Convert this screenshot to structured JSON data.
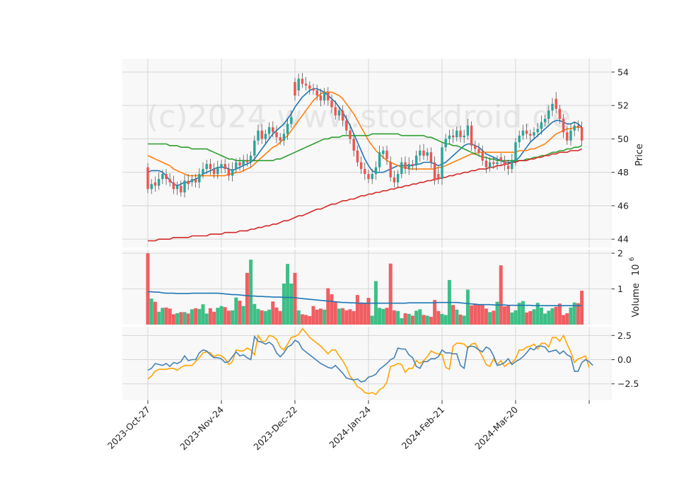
{
  "watermark": "(c)2024 www.stockdroid.de",
  "chart_data": {
    "type": "candlestick",
    "panels": {
      "price": {
        "ylabel": "Price",
        "ylim": [
          43.5,
          54.8
        ],
        "yticks": [
          44,
          46,
          48,
          50,
          52,
          54
        ]
      },
      "volume": {
        "ylabel": "Volume",
        "exponent_label": "10",
        "exponent": "6",
        "ylim": [
          0,
          2.1
        ],
        "yticks": [
          1,
          2
        ]
      },
      "oscillator": {
        "ylim": [
          -4.2,
          3.4
        ],
        "yticks": [
          2.5,
          0.0,
          -2.5
        ],
        "ytick_labels": [
          "2.5",
          "0.0",
          "−2.5"
        ]
      }
    },
    "x_ticks": [
      {
        "index": 0,
        "label": "2023-Oct-27"
      },
      {
        "index": 20,
        "label": "2023-Nov-24"
      },
      {
        "index": 40,
        "label": "2023-Dec-22"
      },
      {
        "index": 60,
        "label": "2024-Jan-24"
      },
      {
        "index": 80,
        "label": "2024-Feb-21"
      },
      {
        "index": 100,
        "label": "2024-Mar-20"
      },
      {
        "index": 120,
        "label": ""
      }
    ],
    "num_bars": 119,
    "close": [
      47.0,
      47.3,
      47.2,
      47.6,
      47.9,
      47.6,
      47.4,
      47.0,
      47.2,
      46.8,
      47.5,
      47.3,
      47.6,
      47.4,
      47.9,
      48.2,
      48.5,
      48.2,
      47.9,
      48.3,
      48.5,
      48.2,
      47.8,
      48.2,
      48.6,
      48.4,
      48.7,
      48.6,
      49.0,
      49.9,
      50.5,
      50.0,
      50.3,
      50.7,
      50.4,
      50.1,
      49.9,
      50.3,
      50.9,
      51.3,
      52.6,
      53.6,
      53.3,
      53.2,
      53.0,
      52.9,
      52.6,
      52.3,
      52.8,
      52.3,
      51.9,
      51.4,
      51.7,
      51.1,
      50.5,
      50.0,
      49.3,
      48.6,
      48.2,
      47.9,
      47.6,
      47.9,
      48.3,
      49.2,
      49.3,
      48.8,
      47.7,
      47.4,
      47.9,
      48.6,
      48.2,
      48.5,
      48.4,
      49.0,
      49.3,
      49.0,
      49.2,
      48.6,
      47.5,
      47.6,
      49.5,
      50.0,
      50.2,
      50.1,
      50.5,
      50.1,
      50.2,
      50.8,
      49.6,
      49.4,
      49.2,
      48.7,
      48.3,
      48.6,
      48.5,
      48.6,
      48.7,
      48.4,
      48.2,
      48.7,
      49.8,
      50.2,
      50.5,
      50.3,
      50.2,
      50.4,
      50.6,
      51.0,
      51.2,
      51.7,
      52.1,
      51.8,
      51.2,
      50.4,
      49.9,
      50.5,
      50.8,
      50.7,
      49.9
    ],
    "open": [
      48.3,
      47.0,
      47.4,
      47.2,
      47.6,
      47.9,
      47.6,
      47.4,
      47.0,
      47.2,
      46.8,
      47.5,
      47.4,
      47.6,
      47.4,
      47.9,
      48.2,
      48.5,
      48.2,
      47.9,
      48.3,
      48.5,
      48.2,
      47.8,
      48.2,
      48.6,
      48.4,
      48.7,
      48.6,
      49.0,
      49.9,
      50.5,
      50.0,
      50.3,
      50.7,
      50.4,
      50.1,
      49.9,
      50.3,
      50.9,
      53.4,
      52.9,
      53.6,
      53.3,
      53.2,
      53.0,
      52.9,
      52.6,
      52.3,
      52.8,
      52.3,
      51.9,
      51.4,
      51.7,
      51.1,
      50.5,
      50.0,
      49.3,
      48.6,
      48.2,
      47.9,
      47.6,
      47.9,
      48.3,
      49.1,
      49.3,
      48.6,
      47.7,
      47.4,
      47.9,
      48.6,
      48.2,
      48.5,
      48.4,
      49.0,
      49.3,
      49.0,
      49.2,
      48.6,
      47.9,
      47.6,
      49.5,
      50.0,
      50.2,
      50.1,
      50.5,
      50.1,
      50.2,
      50.8,
      49.6,
      49.4,
      49.2,
      48.7,
      48.3,
      48.6,
      48.5,
      48.9,
      48.7,
      48.4,
      48.2,
      48.7,
      49.8,
      50.2,
      50.5,
      50.3,
      50.2,
      50.4,
      50.6,
      51.0,
      51.2,
      51.7,
      52.4,
      51.8,
      51.2,
      50.4,
      49.9,
      50.5,
      50.8,
      50.7
    ],
    "volume": [
      2.0,
      0.73,
      0.64,
      0.36,
      0.47,
      0.48,
      0.45,
      0.29,
      0.32,
      0.35,
      0.35,
      0.31,
      0.43,
      0.46,
      0.44,
      0.57,
      0.31,
      0.46,
      0.36,
      0.47,
      0.52,
      0.49,
      0.39,
      0.4,
      0.76,
      0.67,
      0.52,
      1.45,
      1.82,
      0.58,
      0.44,
      0.4,
      0.38,
      0.42,
      0.65,
      0.48,
      0.38,
      1.15,
      1.7,
      1.15,
      1.45,
      0.4,
      0.29,
      0.27,
      0.24,
      0.52,
      0.42,
      0.45,
      0.42,
      1.02,
      0.85,
      0.63,
      0.45,
      0.46,
      0.4,
      0.43,
      0.38,
      0.83,
      0.62,
      0.6,
      0.75,
      0.25,
      1.22,
      0.47,
      0.44,
      0.47,
      1.71,
      0.4,
      0.38,
      0.18,
      0.32,
      0.3,
      0.25,
      0.39,
      0.43,
      0.27,
      0.25,
      0.22,
      0.69,
      0.38,
      0.3,
      0.27,
      1.25,
      0.55,
      0.42,
      0.28,
      0.25,
      0.98,
      0.54,
      0.59,
      0.56,
      0.55,
      0.45,
      0.35,
      0.39,
      0.64,
      1.66,
      0.51,
      0.53,
      0.34,
      0.4,
      0.61,
      0.66,
      0.34,
      0.38,
      0.43,
      0.61,
      0.48,
      0.31,
      0.39,
      0.46,
      0.5,
      0.59,
      0.27,
      0.32,
      0.48,
      0.62,
      0.6,
      0.95
    ],
    "volume_ma": [
      0.92,
      0.92,
      0.91,
      0.91,
      0.89,
      0.88,
      0.88,
      0.88,
      0.87,
      0.87,
      0.87,
      0.87,
      0.88,
      0.88,
      0.88,
      0.88,
      0.88,
      0.88,
      0.88,
      0.88,
      0.87,
      0.86,
      0.85,
      0.84,
      0.84,
      0.83,
      0.82,
      0.81,
      0.8,
      0.8,
      0.79,
      0.79,
      0.78,
      0.78,
      0.77,
      0.77,
      0.77,
      0.76,
      0.76,
      0.76,
      0.75,
      0.74,
      0.73,
      0.72,
      0.71,
      0.7,
      0.69,
      0.68,
      0.67,
      0.66,
      0.65,
      0.64,
      0.63,
      0.62,
      0.62,
      0.61,
      0.61,
      0.6,
      0.6,
      0.6,
      0.6,
      0.6,
      0.6,
      0.6,
      0.6,
      0.6,
      0.6,
      0.6,
      0.6,
      0.6,
      0.6,
      0.61,
      0.61,
      0.61,
      0.61,
      0.61,
      0.61,
      0.61,
      0.61,
      0.62,
      0.62,
      0.62,
      0.62,
      0.62,
      0.62,
      0.61,
      0.6,
      0.59,
      0.58,
      0.57,
      0.56,
      0.56,
      0.56,
      0.56,
      0.55,
      0.55,
      0.55,
      0.55,
      0.54,
      0.54,
      0.54,
      0.54,
      0.54,
      0.54,
      0.54,
      0.53,
      0.53,
      0.53,
      0.53,
      0.53,
      0.53,
      0.53,
      0.53,
      0.53,
      0.53,
      0.53,
      0.53,
      0.53,
      0.53
    ],
    "overlays": [
      {
        "color": "#1f77b4",
        "values": [
          48.0,
          48.1,
          48.1,
          48.1,
          48.0,
          47.8,
          47.5,
          47.3,
          47.2,
          47.3,
          47.4,
          47.4,
          47.5,
          47.6,
          47.7,
          47.9,
          48.0,
          48.1,
          48.2,
          48.3,
          48.3,
          48.3,
          48.2,
          48.1,
          48.2,
          48.3,
          48.4,
          48.5,
          48.6,
          48.8,
          49.1,
          49.4,
          49.7,
          50.0,
          50.3,
          50.5,
          50.7,
          50.9,
          51.2,
          51.5,
          51.9,
          52.2,
          52.5,
          52.7,
          52.9,
          53.0,
          53.0,
          52.9,
          52.8,
          52.6,
          52.4,
          52.2,
          51.9,
          51.6,
          51.2,
          50.8,
          50.3,
          49.8,
          49.3,
          48.8,
          48.4,
          48.1,
          48.0,
          48.0,
          48.0,
          48.1,
          48.2,
          48.3,
          48.4,
          48.4,
          48.4,
          48.4,
          48.4,
          48.5,
          48.5,
          48.6,
          48.6,
          48.6,
          48.5,
          48.4,
          48.5,
          48.6,
          48.8,
          49.0,
          49.2,
          49.4,
          49.6,
          49.7,
          49.7,
          49.6,
          49.5,
          49.3,
          49.1,
          49.0,
          48.9,
          48.8,
          48.7,
          48.6,
          48.6,
          48.6,
          48.7,
          48.9,
          49.2,
          49.5,
          49.8,
          50.0,
          50.2,
          50.4,
          50.6,
          50.8,
          51.0,
          51.1,
          51.1,
          51.0,
          50.9,
          50.9,
          51.0,
          50.9,
          50.7
        ]
      },
      {
        "color": "#ff7f0e",
        "values": [
          49.0,
          48.9,
          48.8,
          48.7,
          48.6,
          48.5,
          48.4,
          48.2,
          48.1,
          48.0,
          47.9,
          47.8,
          47.8,
          47.8,
          47.8,
          47.8,
          47.8,
          47.8,
          47.8,
          47.8,
          47.8,
          47.8,
          47.9,
          47.9,
          48.0,
          48.0,
          48.1,
          48.2,
          48.3,
          48.5,
          48.7,
          48.9,
          49.1,
          49.3,
          49.5,
          49.6,
          49.8,
          50.0,
          50.2,
          50.5,
          50.8,
          51.1,
          51.4,
          51.7,
          52.0,
          52.3,
          52.5,
          52.7,
          52.8,
          52.8,
          52.8,
          52.7,
          52.6,
          52.4,
          52.1,
          51.8,
          51.5,
          51.1,
          50.7,
          50.3,
          49.9,
          49.6,
          49.3,
          49.1,
          48.9,
          48.7,
          48.6,
          48.5,
          48.4,
          48.3,
          48.3,
          48.2,
          48.2,
          48.2,
          48.2,
          48.2,
          48.2,
          48.2,
          48.2,
          48.3,
          48.3,
          48.4,
          48.5,
          48.6,
          48.7,
          48.8,
          48.9,
          49.0,
          49.1,
          49.1,
          49.2,
          49.2,
          49.2,
          49.2,
          49.2,
          49.2,
          49.2,
          49.2,
          49.2,
          49.2,
          49.2,
          49.3,
          49.3,
          49.3,
          49.4,
          49.4,
          49.5,
          49.6,
          49.7,
          49.9,
          50.1,
          50.3,
          50.4,
          50.5,
          50.6,
          50.6,
          50.7,
          50.7,
          50.7
        ]
      },
      {
        "color": "#2ca02c",
        "values": [
          49.7,
          49.7,
          49.7,
          49.7,
          49.7,
          49.7,
          49.6,
          49.6,
          49.6,
          49.5,
          49.5,
          49.5,
          49.4,
          49.4,
          49.4,
          49.4,
          49.4,
          49.3,
          49.2,
          49.1,
          49.0,
          48.9,
          48.8,
          48.8,
          48.7,
          48.7,
          48.7,
          48.7,
          48.7,
          48.7,
          48.7,
          48.7,
          48.7,
          48.7,
          48.7,
          48.8,
          48.8,
          48.9,
          49.0,
          49.1,
          49.2,
          49.3,
          49.4,
          49.5,
          49.6,
          49.7,
          49.8,
          49.9,
          50.0,
          50.0,
          50.1,
          50.1,
          50.1,
          50.2,
          50.2,
          50.2,
          50.2,
          50.2,
          50.2,
          50.2,
          50.2,
          50.3,
          50.3,
          50.3,
          50.3,
          50.3,
          50.3,
          50.3,
          50.3,
          50.2,
          50.2,
          50.2,
          50.2,
          50.2,
          50.2,
          50.2,
          50.1,
          50.1,
          50.0,
          49.9,
          49.8,
          49.7,
          49.7,
          49.6,
          49.6,
          49.5,
          49.4,
          49.3,
          49.2,
          49.1,
          49.0,
          48.9,
          48.9,
          48.8,
          48.8,
          48.7,
          48.7,
          48.7,
          48.7,
          48.7,
          48.7,
          48.7,
          48.7,
          48.8,
          48.8,
          48.9,
          48.9,
          49.0,
          49.0,
          49.1,
          49.2,
          49.2,
          49.3,
          49.3,
          49.4,
          49.4,
          49.5,
          49.5,
          49.6
        ]
      },
      {
        "color": "#d62728",
        "values": [
          43.9,
          43.9,
          43.9,
          44.0,
          44.0,
          44.0,
          44.0,
          44.1,
          44.1,
          44.1,
          44.1,
          44.1,
          44.2,
          44.2,
          44.2,
          44.2,
          44.2,
          44.3,
          44.3,
          44.3,
          44.3,
          44.4,
          44.4,
          44.4,
          44.4,
          44.5,
          44.5,
          44.5,
          44.6,
          44.6,
          44.7,
          44.7,
          44.8,
          44.8,
          44.9,
          44.9,
          45.0,
          45.1,
          45.1,
          45.2,
          45.3,
          45.4,
          45.4,
          45.5,
          45.6,
          45.7,
          45.8,
          45.8,
          45.9,
          46.0,
          46.1,
          46.1,
          46.2,
          46.3,
          46.3,
          46.4,
          46.4,
          46.5,
          46.6,
          46.6,
          46.7,
          46.7,
          46.8,
          46.8,
          46.9,
          46.9,
          47.0,
          47.0,
          47.1,
          47.1,
          47.2,
          47.2,
          47.3,
          47.3,
          47.4,
          47.4,
          47.5,
          47.5,
          47.6,
          47.6,
          47.7,
          47.7,
          47.8,
          47.8,
          47.9,
          47.9,
          48.0,
          48.0,
          48.1,
          48.1,
          48.2,
          48.2,
          48.2,
          48.3,
          48.3,
          48.4,
          48.4,
          48.5,
          48.5,
          48.6,
          48.6,
          48.7,
          48.7,
          48.7,
          48.8,
          48.8,
          48.9,
          48.9,
          49.0,
          49.0,
          49.1,
          49.1,
          49.2,
          49.2,
          49.2,
          49.3,
          49.3,
          49.3,
          49.4
        ]
      }
    ],
    "oscillator_lines": [
      {
        "color": "#ffa500",
        "values": [
          -2.0,
          -1.7,
          -1.2,
          -1.0,
          -1.0,
          -1.0,
          -0.9,
          -0.9,
          -1.1,
          -0.8,
          -0.6,
          -0.6,
          -0.6,
          -0.2,
          0.2,
          0.7,
          0.8,
          0.7,
          0.3,
          0.5,
          0.4,
          0.1,
          -0.5,
          -0.2,
          1.0,
          0.9,
          0.9,
          1.2,
          1.0,
          0.5,
          2.5,
          1.9,
          1.9,
          2.5,
          2.4,
          2.1,
          1.3,
          1.0,
          1.6,
          2.3,
          2.4,
          2.6,
          3.2,
          2.8,
          2.3,
          2.0,
          1.7,
          1.4,
          1.0,
          0.6,
          1.0,
          1.0,
          0.4,
          -0.1,
          -0.8,
          -1.7,
          -2.2,
          -2.8,
          -3.0,
          -3.4,
          -3.5,
          -3.4,
          -3.6,
          -3.1,
          -2.9,
          -2.3,
          -0.7,
          -0.6,
          -0.4,
          -0.5,
          -1.3,
          -0.9,
          -0.9,
          -0.1,
          -0.4,
          -0.1,
          0.3,
          0.9,
          0.7,
          0.6,
          0.5,
          -0.8,
          -1.0,
          1.4,
          1.7,
          1.7,
          1.6,
          1.2,
          1.6,
          1.7,
          1.0,
          0.3,
          -0.5,
          -0.7,
          0.1,
          -0.5,
          -0.1,
          -0.7,
          -0.4,
          -0.3,
          0.1,
          1.0,
          1.0,
          1.3,
          1.4,
          1.6,
          1.1,
          1.7,
          1.7,
          1.3,
          2.3,
          2.3,
          1.9,
          2.5,
          1.6,
          0.8,
          -0.3,
          0.1,
          0.2,
          0.4,
          -0.8
        ]
      },
      {
        "color": "#4682b4",
        "values": [
          -1.1,
          -0.9,
          -0.4,
          -0.5,
          -0.6,
          -0.4,
          -0.7,
          -0.3,
          -0.4,
          -0.2,
          0.4,
          -0.1,
          0.0,
          0.0,
          0.7,
          1.0,
          0.9,
          0.5,
          0.2,
          0.2,
          0.1,
          -0.3,
          -0.2,
          0.3,
          0.8,
          0.4,
          0.5,
          0.2,
          0.0,
          2.4,
          1.9,
          1.8,
          1.6,
          1.8,
          1.5,
          0.7,
          0.3,
          0.7,
          1.3,
          1.5,
          2.0,
          1.8,
          1.1,
          0.8,
          0.5,
          0.2,
          -0.1,
          -0.4,
          -0.6,
          -0.8,
          -0.9,
          -0.6,
          -1.0,
          -1.4,
          -1.9,
          -2.0,
          -2.1,
          -2.0,
          -2.3,
          -2.2,
          -1.8,
          -1.7,
          -1.5,
          -1.0,
          -0.7,
          -0.4,
          0.0,
          0.2,
          1.2,
          1.1,
          1.1,
          0.5,
          0.2,
          -0.7,
          -0.9,
          -0.2,
          -0.2,
          0.1,
          0.1,
          0.3,
          1.0,
          0.7,
          0.7,
          0.6,
          0.6,
          -0.6,
          -0.9,
          1.3,
          1.4,
          1.3,
          1.0,
          0.8,
          1.3,
          1.1,
          0.4,
          -0.6,
          -0.5,
          -0.3,
          0.1,
          -0.5,
          -0.2,
          0.0,
          0.3,
          0.7,
          1.2,
          1.0,
          1.4,
          1.4,
          1.3,
          0.8,
          0.9,
          1.0,
          0.6,
          0.9,
          0.5,
          0.3,
          -1.2,
          -1.2,
          -0.3,
          0.0,
          -0.2,
          -0.6
        ]
      }
    ],
    "colors": {
      "up": "#26a69a",
      "down": "#ef5350",
      "panel_bg": "#f8f8f8",
      "grid": "#d6d6d6"
    }
  }
}
